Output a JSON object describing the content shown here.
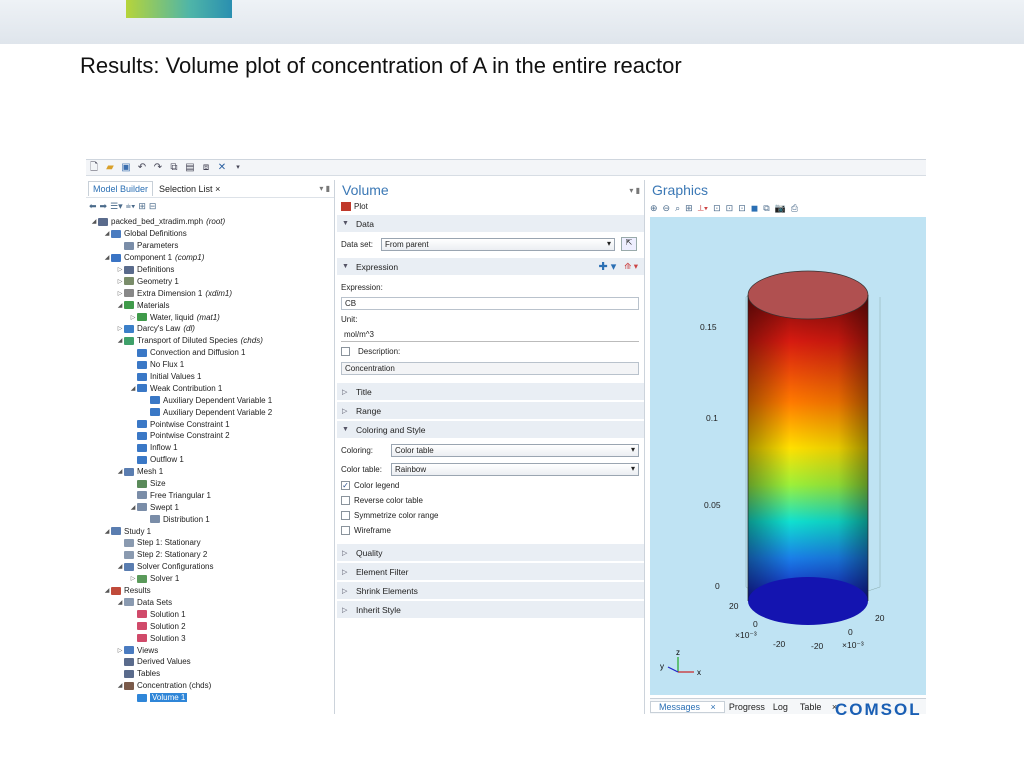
{
  "slide": {
    "title": "Results: Volume plot of concentration of A in the entire reactor",
    "footer_logo": "COMSOL"
  },
  "toolbar": {
    "icons": [
      "new-icon",
      "open-icon",
      "save-icon",
      "undo-icon",
      "redo-icon",
      "copy-icon",
      "paste-icon",
      "duplicate-icon",
      "delete-icon"
    ]
  },
  "model_builder": {
    "tabs": [
      "Model Builder",
      "Selection List"
    ],
    "close_glyph": "×",
    "tree": [
      {
        "label": "packed_bed_xtradim.mph",
        "tag": "(root)",
        "level": 0,
        "tog": "◢",
        "color": "#5a6b8c"
      },
      {
        "label": "Global Definitions",
        "tag": "",
        "level": 1,
        "tog": "◢",
        "color": "#4a7bc0"
      },
      {
        "label": "Parameters",
        "tag": "",
        "level": 2,
        "tog": "",
        "color": "#7a8da8"
      },
      {
        "label": "Component 1",
        "tag": "(comp1)",
        "level": 1,
        "tog": "◢",
        "color": "#3a74c4"
      },
      {
        "label": "Definitions",
        "tag": "",
        "level": 2,
        "tog": "▷",
        "color": "#5a6b8c"
      },
      {
        "label": "Geometry 1",
        "tag": "",
        "level": 2,
        "tog": "▷",
        "color": "#7a8d6a"
      },
      {
        "label": "Extra Dimension 1",
        "tag": "(xdim1)",
        "level": 2,
        "tog": "▷",
        "color": "#888"
      },
      {
        "label": "Materials",
        "tag": "",
        "level": 2,
        "tog": "◢",
        "color": "#3f9a4a"
      },
      {
        "label": "Water, liquid",
        "tag": "(mat1)",
        "level": 3,
        "tog": "▷",
        "color": "#3f9a4a"
      },
      {
        "label": "Darcy's Law",
        "tag": "(dl)",
        "level": 2,
        "tog": "▷",
        "color": "#3b7fc8"
      },
      {
        "label": "Transport of Diluted Species",
        "tag": "(chds)",
        "level": 2,
        "tog": "◢",
        "color": "#3fa06a"
      },
      {
        "label": "Convection and Diffusion 1",
        "tag": "",
        "level": 3,
        "tog": "",
        "color": "#3a78c6"
      },
      {
        "label": "No Flux 1",
        "tag": "",
        "level": 3,
        "tog": "",
        "color": "#3a78c6"
      },
      {
        "label": "Initial Values 1",
        "tag": "",
        "level": 3,
        "tog": "",
        "color": "#3a78c6"
      },
      {
        "label": "Weak Contribution 1",
        "tag": "",
        "level": 3,
        "tog": "◢",
        "color": "#3a78c6"
      },
      {
        "label": "Auxiliary Dependent Variable 1",
        "tag": "",
        "level": 4,
        "tog": "",
        "color": "#3a78c6"
      },
      {
        "label": "Auxiliary Dependent Variable 2",
        "tag": "",
        "level": 4,
        "tog": "",
        "color": "#3a78c6"
      },
      {
        "label": "Pointwise Constraint 1",
        "tag": "",
        "level": 3,
        "tog": "",
        "color": "#3a78c6"
      },
      {
        "label": "Pointwise Constraint 2",
        "tag": "",
        "level": 3,
        "tog": "",
        "color": "#3a78c6"
      },
      {
        "label": "Inflow 1",
        "tag": "",
        "level": 3,
        "tog": "",
        "color": "#3a78c6"
      },
      {
        "label": "Outflow 1",
        "tag": "",
        "level": 3,
        "tog": "",
        "color": "#3a78c6"
      },
      {
        "label": "Mesh 1",
        "tag": "",
        "level": 2,
        "tog": "◢",
        "color": "#5a7db0"
      },
      {
        "label": "Size",
        "tag": "",
        "level": 3,
        "tog": "",
        "color": "#5a8a5a"
      },
      {
        "label": "Free Triangular 1",
        "tag": "",
        "level": 3,
        "tog": "",
        "color": "#7a8da8"
      },
      {
        "label": "Swept 1",
        "tag": "",
        "level": 3,
        "tog": "◢",
        "color": "#7a8da8"
      },
      {
        "label": "Distribution 1",
        "tag": "",
        "level": 4,
        "tog": "",
        "color": "#7a8da8"
      },
      {
        "label": "Study 1",
        "tag": "",
        "level": 1,
        "tog": "◢",
        "color": "#5a7db0"
      },
      {
        "label": "Step 1: Stationary",
        "tag": "",
        "level": 2,
        "tog": "",
        "color": "#8a9ab0"
      },
      {
        "label": "Step 2: Stationary 2",
        "tag": "",
        "level": 2,
        "tog": "",
        "color": "#8a9ab0"
      },
      {
        "label": "Solver Configurations",
        "tag": "",
        "level": 2,
        "tog": "◢",
        "color": "#5a7db0"
      },
      {
        "label": "Solver 1",
        "tag": "",
        "level": 3,
        "tog": "▷",
        "color": "#5a9a5a"
      },
      {
        "label": "Results",
        "tag": "",
        "level": 1,
        "tog": "◢",
        "color": "#c04a3a"
      },
      {
        "label": "Data Sets",
        "tag": "",
        "level": 2,
        "tog": "◢",
        "color": "#8a9ab0"
      },
      {
        "label": "Solution 1",
        "tag": "",
        "level": 3,
        "tog": "",
        "color": "#d04a6a"
      },
      {
        "label": "Solution 2",
        "tag": "",
        "level": 3,
        "tog": "",
        "color": "#d04a6a"
      },
      {
        "label": "Solution 3",
        "tag": "",
        "level": 3,
        "tog": "",
        "color": "#d04a6a"
      },
      {
        "label": "Views",
        "tag": "",
        "level": 2,
        "tog": "▷",
        "color": "#4a7bc0"
      },
      {
        "label": "Derived Values",
        "tag": "",
        "level": 2,
        "tog": "",
        "color": "#5a6b8c"
      },
      {
        "label": "Tables",
        "tag": "",
        "level": 2,
        "tog": "",
        "color": "#5a6b8c"
      },
      {
        "label": "Concentration (chds)",
        "tag": "",
        "level": 2,
        "tog": "◢",
        "color": "#7a5a4a"
      },
      {
        "label": "Volume 1",
        "tag": "",
        "level": 3,
        "tog": "",
        "color": "#2f86d8",
        "selected": true
      }
    ]
  },
  "volume": {
    "title": "Volume",
    "plot_label": "Plot",
    "data_section": "Data",
    "dataset_label": "Data set:",
    "dataset_value": "From parent",
    "expression_section": "Expression",
    "expression_label": "Expression:",
    "expression_value": "CB",
    "unit_label": "Unit:",
    "unit_value": "mol/m^3",
    "description_label": "Description:",
    "description_value": "Concentration",
    "title_section": "Title",
    "range_section": "Range",
    "coloring_section": "Coloring and Style",
    "coloring_label": "Coloring:",
    "coloring_value": "Color table",
    "colortable_label": "Color table:",
    "colortable_value": "Rainbow",
    "options": [
      {
        "label": "Color legend",
        "checked": true
      },
      {
        "label": "Reverse color table",
        "checked": false
      },
      {
        "label": "Symmetrize color range",
        "checked": false
      },
      {
        "label": "Wireframe",
        "checked": false
      }
    ],
    "collapsed_sections": [
      "Quality",
      "Element Filter",
      "Shrink Elements",
      "Inherit Style"
    ]
  },
  "graphics": {
    "title": "Graphics",
    "z_ticks": [
      "0.15",
      "0.1",
      "0.05",
      "0"
    ],
    "axis_bottom": [
      "20",
      "0",
      "×10⁻³",
      "-20",
      "-20",
      "0",
      "×10⁻³",
      "20"
    ],
    "triad": {
      "x": "x",
      "y": "y",
      "z": "z"
    },
    "colors": {
      "top": "#b05050",
      "canvas": "#bfe3f3",
      "accent": "#3b78b5"
    }
  },
  "messages": {
    "tabs": [
      "Messages",
      "Progress",
      "Log",
      "Table"
    ]
  }
}
